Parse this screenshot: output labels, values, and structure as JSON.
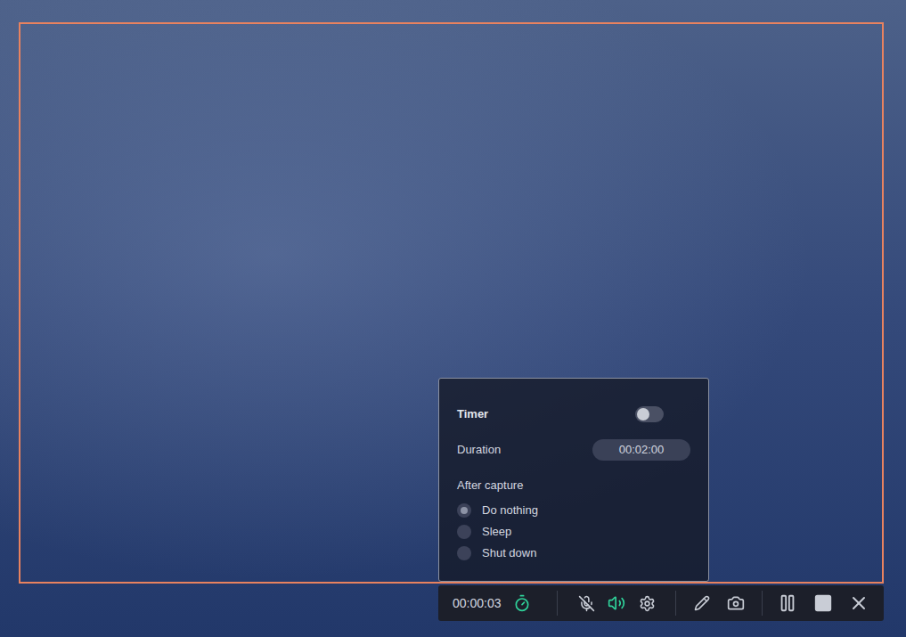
{
  "recording_area": {
    "shown": true
  },
  "timer_panel": {
    "open": true,
    "title": "Timer",
    "on": false,
    "duration_label": "Duration",
    "duration": "00:02:00",
    "after_capture_label": "After capture",
    "options": [
      {
        "label": "Do nothing",
        "selected": true
      },
      {
        "label": "Sleep",
        "selected": false
      },
      {
        "label": "Shut down",
        "selected": false
      }
    ]
  },
  "toolbar": {
    "elapsed": "00:00:03",
    "timer_active": true,
    "microphone_muted": true,
    "system_audio_on": true
  }
}
